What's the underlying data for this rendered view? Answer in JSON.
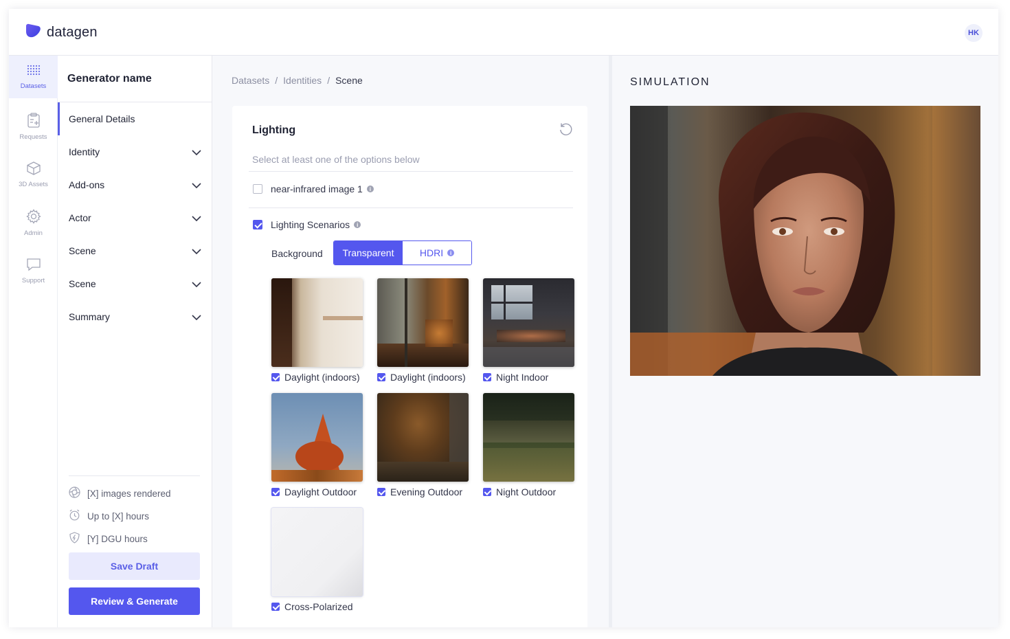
{
  "app": {
    "name": "datagen",
    "user_initials": "HK"
  },
  "rail": [
    {
      "label": "Datasets",
      "icon": "grid-icon",
      "active": true
    },
    {
      "label": "Requests",
      "icon": "clipboard-icon",
      "active": false
    },
    {
      "label": "3D Assets",
      "icon": "cube-icon",
      "active": false
    },
    {
      "label": "Admin",
      "icon": "gear-icon",
      "active": false
    },
    {
      "label": "Support",
      "icon": "chat-icon",
      "active": false
    }
  ],
  "sidenav": {
    "title": "Generator name",
    "items": [
      {
        "label": "General Details"
      },
      {
        "label": "Identity"
      },
      {
        "label": "Add-ons"
      },
      {
        "label": "Actor"
      },
      {
        "label": "Scene"
      },
      {
        "label": "Scene"
      },
      {
        "label": "Summary"
      }
    ],
    "stats": [
      {
        "text": "[X] images rendered",
        "icon": "aperture-icon"
      },
      {
        "text": "Up to [X] hours",
        "icon": "alarm-clock-icon"
      },
      {
        "text": "[Y] DGU hours",
        "icon": "shield-bolt-icon"
      }
    ],
    "save_draft": "Save Draft",
    "review_generate": "Review & Generate"
  },
  "breadcrumb": [
    "Datasets",
    "Identities",
    "Scene"
  ],
  "lighting": {
    "title": "Lighting",
    "hint": "Select at least one of the options below",
    "options": [
      {
        "label": "near-infrared image 1",
        "checked": false
      },
      {
        "label": "Lighting Scenarios",
        "checked": true
      }
    ],
    "background_label": "Background",
    "background_options": [
      "Transparent",
      "HDRI"
    ],
    "background_selected": "Transparent",
    "scenarios": [
      {
        "label": "Daylight (indoors)",
        "checked": true
      },
      {
        "label": "Daylight (indoors)",
        "checked": true
      },
      {
        "label": "Night Indoor",
        "checked": true
      },
      {
        "label": "Daylight Outdoor",
        "checked": true
      },
      {
        "label": "Evening Outdoor",
        "checked": true
      },
      {
        "label": "Night Outdoor",
        "checked": true
      },
      {
        "label": "Cross-Polarized",
        "checked": true
      }
    ]
  },
  "simulation": {
    "title": "SIMULATION"
  },
  "colors": {
    "accent": "#5457ee",
    "accent_light": "#e9eafd"
  }
}
